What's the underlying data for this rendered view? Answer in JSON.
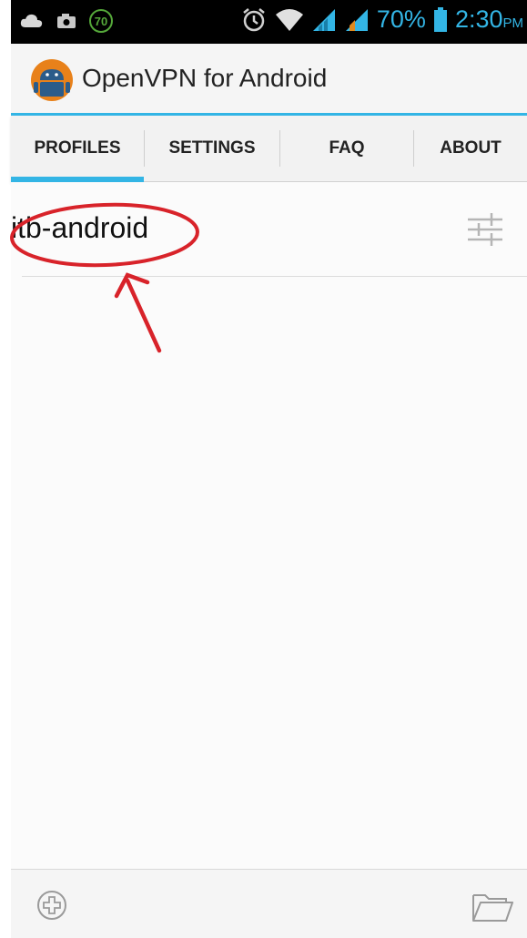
{
  "status_bar": {
    "left_icons": [
      "cloud-icon",
      "camera-icon",
      "badge-70-icon"
    ],
    "badge_text": "70",
    "battery_percent": "70%",
    "time": "2:30",
    "ampm": "PM",
    "accent_color": "#33b5e5"
  },
  "action_bar": {
    "title": "OpenVPN for Android",
    "logo_icon": "openvpn-android-logo"
  },
  "tabs": [
    {
      "label": "PROFILES",
      "selected": true
    },
    {
      "label": "SETTINGS",
      "selected": false
    },
    {
      "label": "FAQ",
      "selected": false
    },
    {
      "label": "ABOUT",
      "selected": false
    }
  ],
  "profiles": [
    {
      "name": "itb-android",
      "edit_icon": "sliders-icon"
    }
  ],
  "bottom_bar": {
    "left_icon": "add-icon",
    "right_icon": "folder-icon"
  },
  "annotation": {
    "color": "#d8232a",
    "shapes": [
      "ellipse-highlight",
      "arrow"
    ]
  }
}
